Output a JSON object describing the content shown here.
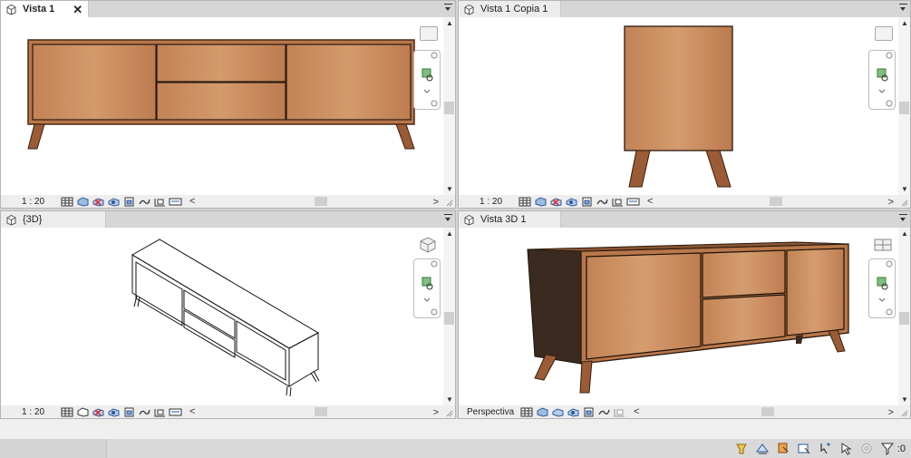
{
  "views": [
    {
      "tab": "Vista 1",
      "scale": "1 : 20",
      "active": true,
      "close": "✕"
    },
    {
      "tab": "Vista 1 Copia 1",
      "scale": "1 : 20",
      "active": false
    },
    {
      "tab": "{3D}",
      "scale": "1 : 20",
      "active": false
    },
    {
      "tab": "Vista 3D 1",
      "scale": "Perspectiva",
      "active": false
    }
  ],
  "view_control_icons": [
    "detail-level-icon",
    "visual-style-icon",
    "sun-path-icon",
    "shadows-icon",
    "crop-view-icon",
    "show-crop-icon",
    "hide-isolate-icon",
    "reveal-hidden-icon",
    "temp-view-props-icon"
  ],
  "statusbar": {
    "filter_count": ":0"
  },
  "colors": {
    "wood": "#c98a5c",
    "wood_dark": "#a5643a",
    "leg": "#9a5b35",
    "side_dark": "#3b2a20"
  }
}
